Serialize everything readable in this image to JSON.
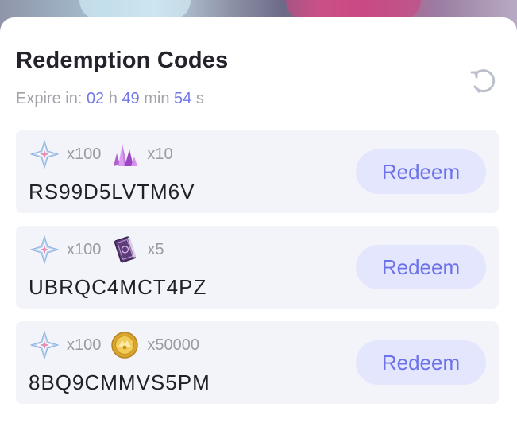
{
  "header": {
    "title": "Redemption Codes",
    "refresh_icon": "refresh-icon"
  },
  "expire": {
    "label": "Expire in:",
    "hours": "02",
    "hours_unit": "h",
    "minutes": "49",
    "minutes_unit": "min",
    "seconds": "54",
    "seconds_unit": "s"
  },
  "codes": [
    {
      "rewards": [
        {
          "icon": "primogem-icon",
          "qty": "x100"
        },
        {
          "icon": "crystal-icon",
          "qty": "x10"
        }
      ],
      "code": "RS99D5LVTM6V",
      "button_label": "Redeem"
    },
    {
      "rewards": [
        {
          "icon": "primogem-icon",
          "qty": "x100"
        },
        {
          "icon": "book-icon",
          "qty": "x5"
        }
      ],
      "code": "UBRQC4MCT4PZ",
      "button_label": "Redeem"
    },
    {
      "rewards": [
        {
          "icon": "primogem-icon",
          "qty": "x100"
        },
        {
          "icon": "coin-icon",
          "qty": "x50000"
        }
      ],
      "code": "8BQ9CMMVS5PM",
      "button_label": "Redeem"
    }
  ],
  "colors": {
    "accent": "#6b72ea",
    "button_bg": "#e4e6fd",
    "card_bg": "#f3f4fa",
    "muted_text": "#a2a2aa"
  }
}
